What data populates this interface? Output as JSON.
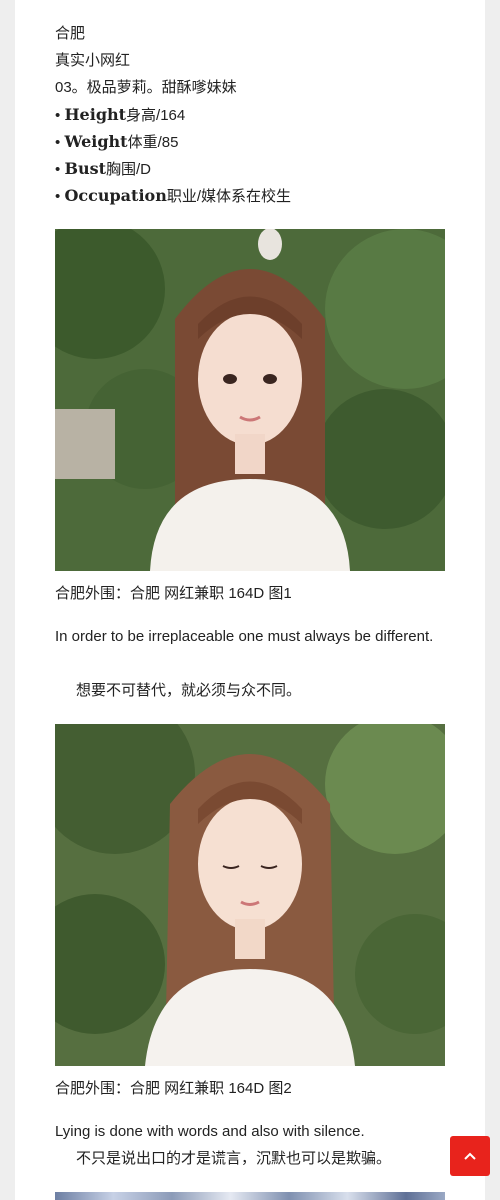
{
  "intro": {
    "city": "合肥",
    "subtitle": "真实小网红",
    "headline": "03。极品萝莉。甜酥嗲妹妹",
    "stats": [
      {
        "bullet": "•",
        "label": "Height",
        "value": "身高/164"
      },
      {
        "bullet": "•",
        "label": "Weight",
        "value": "体重/85"
      },
      {
        "bullet": "•",
        "label": "Bust",
        "value": "胸围/D"
      },
      {
        "bullet": "•",
        "label": "Occupation",
        "value": "职业/媒体系在校生"
      }
    ]
  },
  "posts": [
    {
      "caption": "合肥外围：合肥 网红兼职 164D 图1",
      "quote_en": "In order to be irreplaceable one must always be different.",
      "quote_zh": "想要不可替代，就必须与众不同。"
    },
    {
      "caption": "合肥外围：合肥 网红兼职 164D 图2",
      "quote_en": "Lying is done with words and also with silence.",
      "quote_zh": "不只是说出口的才是谎言，沉默也可以是欺骗。"
    }
  ],
  "back_to_top": {
    "icon": "chevron-up-icon",
    "color": "#e8231c"
  }
}
